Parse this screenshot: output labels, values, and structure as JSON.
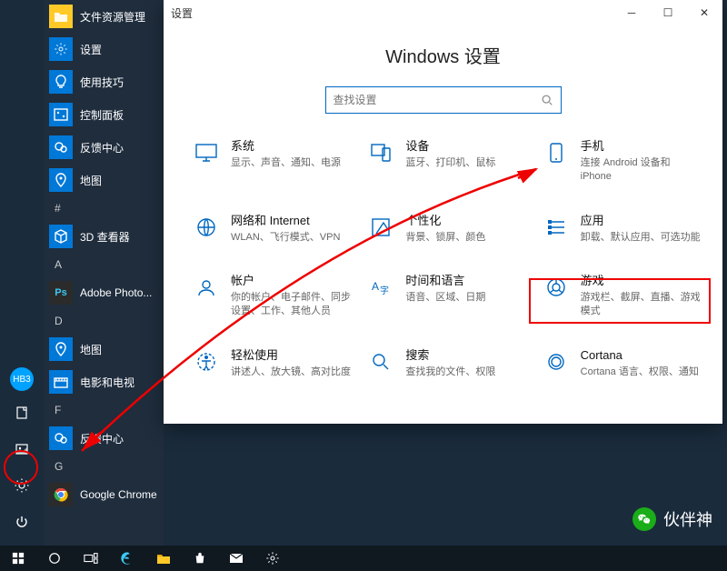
{
  "rail": {
    "avatar_label": "HB3"
  },
  "start_menu": {
    "pinned": [
      {
        "label": "文件资源管理",
        "icon": "folder",
        "color": "yellow"
      },
      {
        "label": "设置",
        "icon": "gear",
        "color": "blue"
      },
      {
        "label": "使用技巧",
        "icon": "bulb",
        "color": "blue"
      },
      {
        "label": "控制面板",
        "icon": "control",
        "color": "blue"
      },
      {
        "label": "反馈中心",
        "icon": "feedback",
        "color": "blue"
      },
      {
        "label": "地图",
        "icon": "map",
        "color": "blue"
      }
    ],
    "groups": [
      {
        "letter": "#",
        "items": [
          {
            "label": "3D 查看器",
            "icon": "cube",
            "color": "blue"
          }
        ]
      },
      {
        "letter": "A",
        "items": [
          {
            "label": "Adobe Photo...",
            "icon": "ps",
            "color": "dark"
          }
        ]
      },
      {
        "letter": "D",
        "items": [
          {
            "label": "地图",
            "icon": "map",
            "color": "blue"
          },
          {
            "label": "电影和电视",
            "icon": "movie",
            "color": "blue"
          }
        ]
      },
      {
        "letter": "F",
        "items": [
          {
            "label": "反馈中心",
            "icon": "feedback",
            "color": "blue"
          }
        ]
      },
      {
        "letter": "G",
        "items": [
          {
            "label": "Google Chrome",
            "icon": "chrome",
            "color": "dark"
          }
        ]
      }
    ]
  },
  "settings": {
    "window_title": "设置",
    "heading": "Windows 设置",
    "search_placeholder": "查找设置",
    "categories": [
      {
        "id": "system",
        "title": "系统",
        "desc": "显示、声音、通知、电源"
      },
      {
        "id": "devices",
        "title": "设备",
        "desc": "蓝牙、打印机、鼠标"
      },
      {
        "id": "phone",
        "title": "手机",
        "desc": "连接 Android 设备和 iPhone"
      },
      {
        "id": "network",
        "title": "网络和 Internet",
        "desc": "WLAN、飞行模式、VPN"
      },
      {
        "id": "personal",
        "title": "个性化",
        "desc": "背景、锁屏、颜色"
      },
      {
        "id": "apps",
        "title": "应用",
        "desc": "卸载、默认应用、可选功能"
      },
      {
        "id": "accounts",
        "title": "帐户",
        "desc": "你的帐户、电子邮件、同步设置、工作、其他人员"
      },
      {
        "id": "time",
        "title": "时间和语言",
        "desc": "语音、区域、日期"
      },
      {
        "id": "gaming",
        "title": "游戏",
        "desc": "游戏栏、截屏、直播、游戏模式"
      },
      {
        "id": "ease",
        "title": "轻松使用",
        "desc": "讲述人、放大镜、高对比度"
      },
      {
        "id": "search",
        "title": "搜索",
        "desc": "查找我的文件、权限"
      },
      {
        "id": "cortana",
        "title": "Cortana",
        "desc": "Cortana 语言、权限、通知"
      }
    ]
  },
  "watermark": {
    "text": "伙伴神"
  },
  "colors": {
    "accent": "#0067c0",
    "annotation": "#e00000"
  }
}
